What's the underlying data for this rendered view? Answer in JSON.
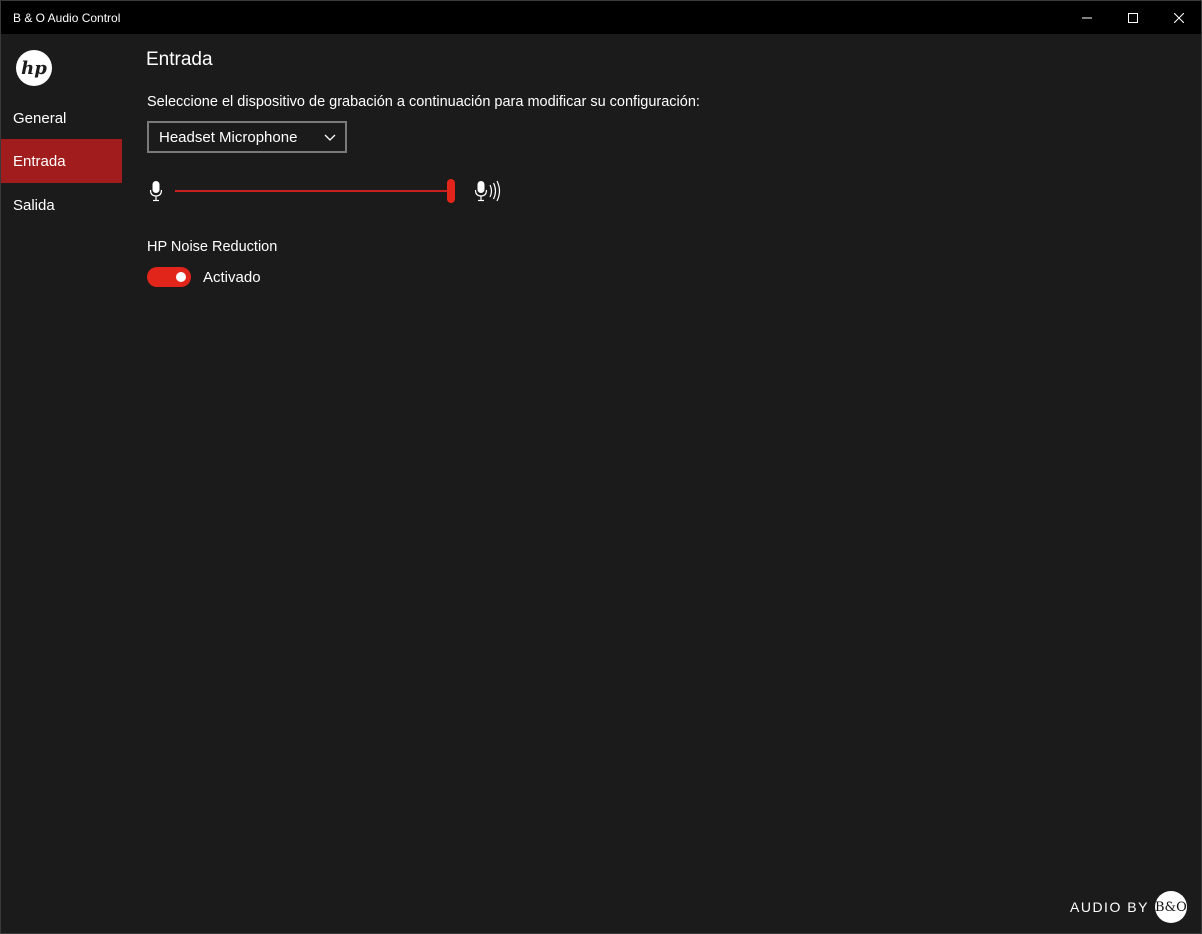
{
  "window": {
    "title": "B & O Audio Control"
  },
  "sidebar": {
    "logo_icon": "hp-logo-icon",
    "items": [
      {
        "label": "General",
        "active": false
      },
      {
        "label": "Entrada",
        "active": true
      },
      {
        "label": "Salida",
        "active": false
      }
    ]
  },
  "main": {
    "title": "Entrada",
    "instruction": "Seleccione el dispositivo de grabación a continuación para modificar su configuración:",
    "device_select": {
      "value": "Headset Microphone"
    },
    "input_level": {
      "value_fraction": 1.0,
      "min_icon": "microphone-icon",
      "max_icon": "microphone-loud-icon"
    },
    "noise_reduction": {
      "label": "HP Noise Reduction",
      "state_label": "Activado",
      "enabled": true
    }
  },
  "footer": {
    "brand_text": "AUDIO BY",
    "badge_text": "B&O"
  },
  "colors": {
    "accent": "#e1251b",
    "active_nav": "#a11d1d",
    "background": "#1b1b1b",
    "titlebar": "#000000"
  }
}
